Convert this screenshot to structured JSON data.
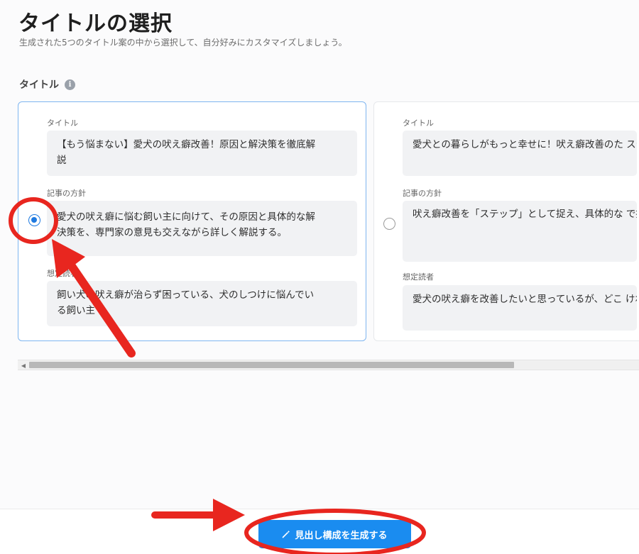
{
  "page": {
    "title": "タイトルの選択",
    "subtitle": "生成された5つのタイトル案の中から選択して、自分好みにカスタマイズしましょう。"
  },
  "section": {
    "label": "タイトル",
    "info_icon": "info-icon",
    "info_glyph": "i"
  },
  "cards": [
    {
      "selected": true,
      "title_label": "タイトル",
      "title_value": "【もう悩まない】愛犬の吠え癖改善！原因と解決策を徹底解\n説",
      "policy_label": "記事の方針",
      "policy_value": "愛犬の吠え癖に悩む飼い主に向けて、その原因と具体的な解\n決策を、専門家の意見も交えながら詳しく解説する。",
      "reader_label": "想定読者",
      "reader_value": "飼い犬の吠え癖が治らず困っている、犬のしつけに悩んでい\nる飼い主"
    },
    {
      "selected": false,
      "title_label": "タイトル",
      "title_value": "愛犬との暮らしがもっと幸せに！吠え癖改善のた\nステップ",
      "policy_label": "記事の方針",
      "policy_value": "吠え癖改善を「ステップ」として捉え、具体的な\nで提示することで、飼い主が無理なく取り組め\nく。専門用語は控え、親しみやすいトーンで解説",
      "reader_label": "想定読者",
      "reader_value": "愛犬の吠え癖を改善したいと思っているが、どこ\nければいいか分からない、具体的な方法を知りた"
    }
  ],
  "footer": {
    "generate_button_label": "見出し構成を生成する",
    "generate_button_icon": "magic-wand-icon"
  },
  "colors": {
    "accent": "#1a8cf0",
    "annotation": "#e8261f"
  }
}
